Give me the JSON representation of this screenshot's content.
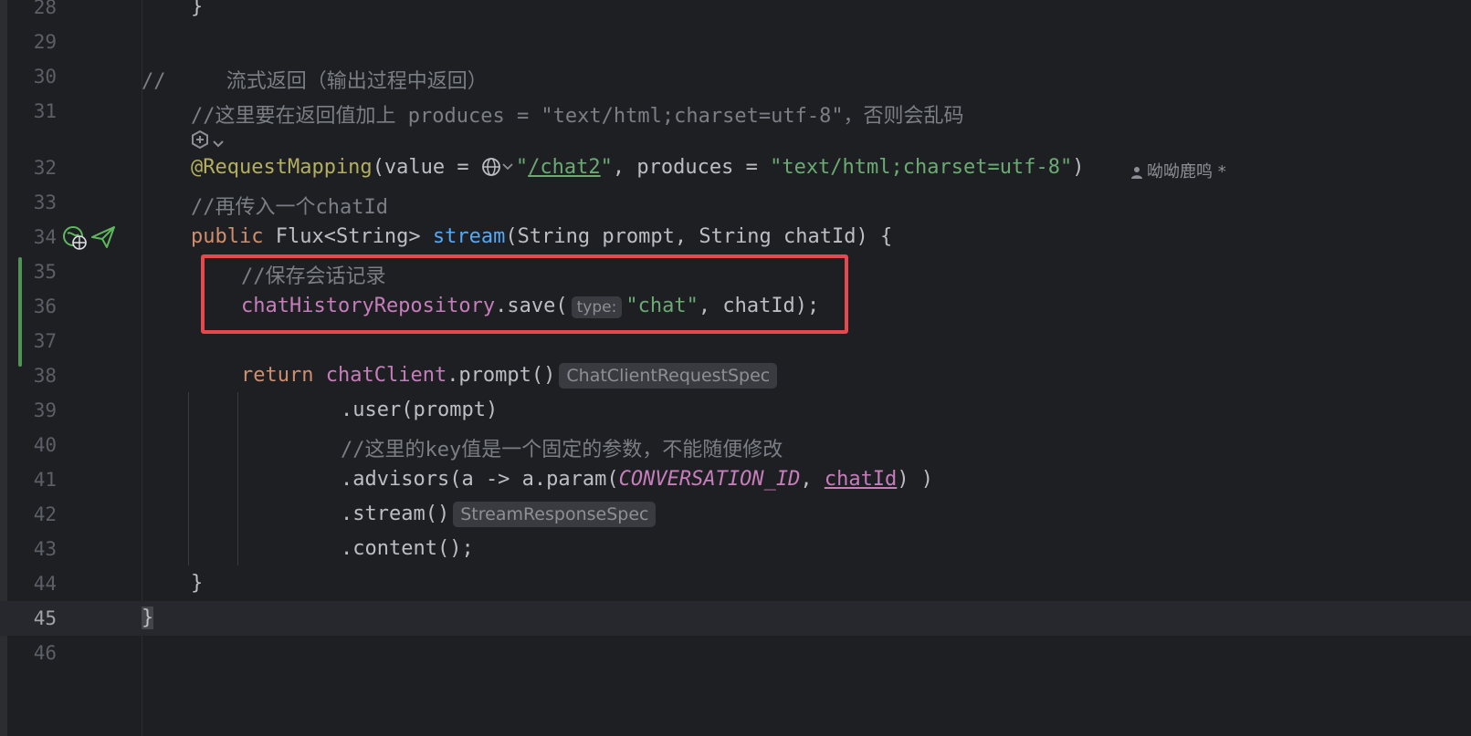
{
  "line_numbers": [
    "28",
    "29",
    "30",
    "31",
    "32",
    "33",
    "34",
    "35",
    "36",
    "37",
    "38",
    "39",
    "40",
    "41",
    "42",
    "43",
    "44",
    "45",
    "46"
  ],
  "code": {
    "l28_brace": "}",
    "l30_comment": "//     流式返回（输出过程中返回）",
    "l31_comment": "//这里要在返回值加上 produces = \"text/html;charset=utf-8\"，否则会乱码",
    "l32_annotation": "@RequestMapping",
    "l32_p1": "(value = ",
    "l32_q1": "\"",
    "l32_url": "/chat2",
    "l32_q2": "\"",
    "l32_p2": ", produces = ",
    "l32_str": "\"text/html;charset=utf-8\"",
    "l32_p3": ")",
    "l33_comment": "//再传入一个chatId",
    "l34_kw": "public",
    "l34_p1": " Flux<String> ",
    "l34_fn": "stream",
    "l34_p2": "(String prompt, String chatId) {",
    "l35_comment": "//保存会话记录",
    "l36_field": "chatHistoryRepository",
    "l36_p1": ".save(",
    "l36_hint": "type:",
    "l36_str": "\"chat\"",
    "l36_p2": ", chatId);",
    "l38_kw": "return",
    "l38_field": "chatClient",
    "l38_p1": ".prompt()",
    "l38_hint": "ChatClientRequestSpec",
    "l39": ".user(prompt)",
    "l40_comment": "//这里的key值是一个固定的参数，不能随便修改",
    "l41_p1": ".advisors(a -> a.param(",
    "l41_const": "CONVERSATION_ID",
    "l41_p2": ", ",
    "l41_var": "chatId",
    "l41_p3": ") )",
    "l42_p1": ".stream()",
    "l42_hint": "StreamResponseSpec",
    "l43": ".content();",
    "l44_brace": "}",
    "l45_brace": "}"
  },
  "author": "呦呦鹿鸣 *",
  "icons": [
    "ai-assistant-icon",
    "chevron-down-icon",
    "globe-icon",
    "web-endpoint-icon",
    "send-request-icon",
    "person-icon"
  ],
  "colors": {
    "background": "#1e1f22",
    "highlight_box": "#e5484d",
    "vcs_added": "#549159"
  }
}
